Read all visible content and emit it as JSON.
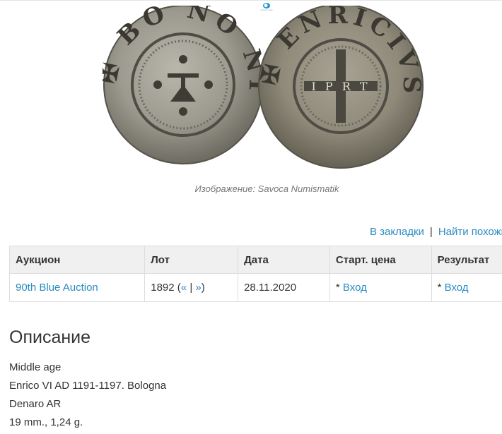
{
  "site": {
    "logo_icon": "site-logo-icon",
    "logo_text": "savoca coins"
  },
  "image": {
    "caption": "Изображение: Savoca Numismatik",
    "obverse_legend": "✠ BO NO NI",
    "reverse_legend": "✠ ENRICIVS",
    "reverse_center": "I P R T"
  },
  "actions": {
    "bookmark": "В закладки",
    "separator": "|",
    "find_similar": "Найти похожие"
  },
  "table": {
    "headers": [
      "Аукцион",
      "Лот",
      "Дата",
      "Старт. цена",
      "Результат"
    ],
    "row": {
      "auction": "90th Blue Auction",
      "lot": "1892",
      "lot_prev": "«",
      "lot_sep": "|",
      "lot_next": "»",
      "date": "28.11.2020",
      "start_prefix": "*",
      "start_link": "Вход",
      "result_prefix": "*",
      "result_link": "Вход"
    }
  },
  "description": {
    "title": "Описание",
    "lines": [
      "Middle age",
      "Enrico VI AD 1191-1197. Bologna",
      "Denaro AR",
      "19 mm., 1,24 g."
    ]
  },
  "colors": {
    "link": "#2a8bc0",
    "header_bg": "#f0f0f0",
    "border": "#dddddd",
    "coin_silver": "#9c9a8e"
  }
}
